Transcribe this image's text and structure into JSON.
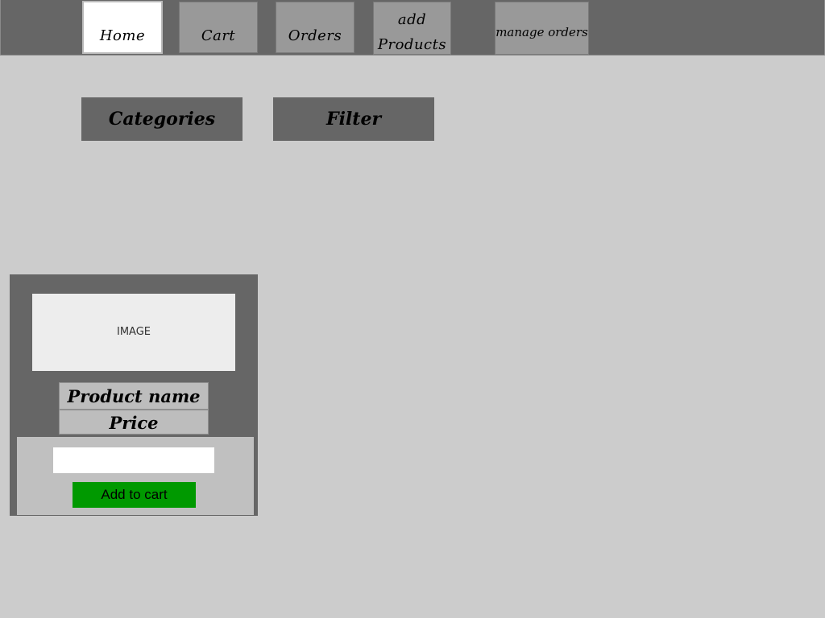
{
  "nav": {
    "home": "Home",
    "cart": "Cart",
    "orders": "Orders",
    "add_products_line1": "add",
    "add_products_line2": "Products",
    "manage_orders": "manage orders",
    "active": "Home"
  },
  "controls": {
    "categories": "Categories",
    "filter": "Filter"
  },
  "product_card": {
    "image_placeholder": "IMAGE",
    "name": "Product name",
    "price": "Price",
    "quantity_value": "",
    "add_to_cart": "Add to cart"
  },
  "colors": {
    "background": "#cccccc",
    "topbar": "#666666",
    "nav_button": "#999999",
    "nav_active": "#ffffff",
    "add_to_cart": "#009900"
  }
}
